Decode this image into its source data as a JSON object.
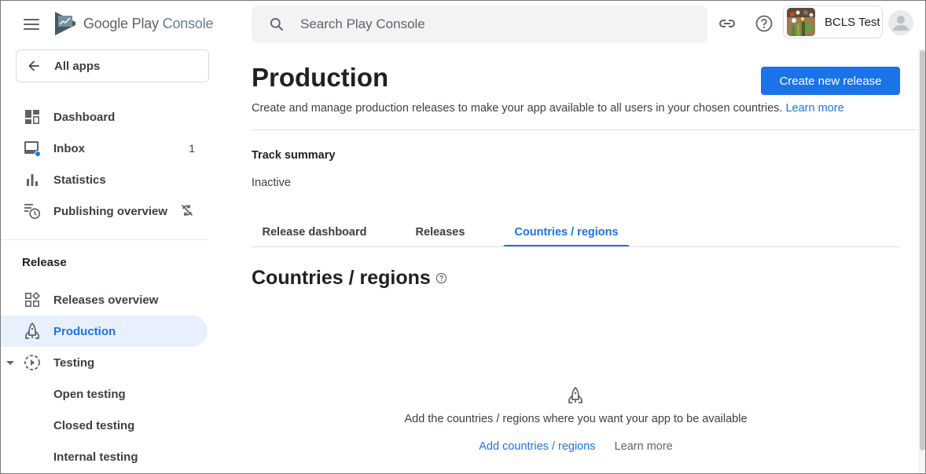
{
  "app": {
    "logo_text_primary": "Google Play",
    "logo_text_secondary": "Console",
    "accent_color": "#1a73e8"
  },
  "sidebar": {
    "back_label": "All apps",
    "items": [
      {
        "label": "Dashboard",
        "icon": "dashboard-icon"
      },
      {
        "label": "Inbox",
        "icon": "inbox-icon",
        "badge": "1"
      },
      {
        "label": "Statistics",
        "icon": "bar-chart-icon"
      },
      {
        "label": "Publishing overview",
        "icon": "schedule-list-icon",
        "trailing_icon": "sync-disabled-icon"
      }
    ],
    "section_title": "Release",
    "release_items": [
      {
        "label": "Releases overview",
        "icon": "releases-overview-icon"
      },
      {
        "label": "Production",
        "icon": "rocket-icon",
        "active": true
      },
      {
        "label": "Testing",
        "icon": "testing-play-icon",
        "expanded": true
      }
    ],
    "testing_subitems": [
      "Open testing",
      "Closed testing",
      "Internal testing"
    ]
  },
  "topbar": {
    "search_placeholder": "Search Play Console",
    "app_name": "BCLS Test"
  },
  "main": {
    "title": "Production",
    "create_button": "Create new release",
    "description": "Create and manage production releases to make your app available to all users in your chosen countries.",
    "description_link": "Learn more",
    "track_summary_title": "Track summary",
    "track_status": "Inactive",
    "tabs": [
      {
        "label": "Release dashboard",
        "active": false
      },
      {
        "label": "Releases",
        "active": false
      },
      {
        "label": "Countries / regions",
        "active": true
      }
    ],
    "section_title": "Countries / regions",
    "empty_state": {
      "message": "Add the countries / regions where you want your app to be available",
      "primary_link": "Add countries / regions",
      "secondary_link": "Learn more"
    }
  }
}
